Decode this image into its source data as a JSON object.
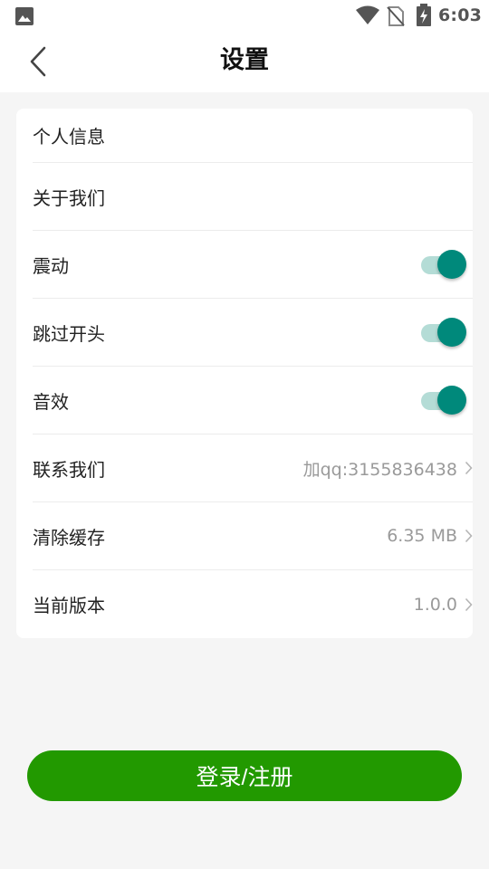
{
  "status_bar": {
    "time": "6:03",
    "icons": [
      "gallery-icon",
      "wifi-icon",
      "no-sim-icon",
      "battery-charging-icon"
    ]
  },
  "header": {
    "title": "设置",
    "back_icon": "chevron-left-icon"
  },
  "settings": {
    "items": [
      {
        "label": "个人信息",
        "type": "link"
      },
      {
        "label": "关于我们",
        "type": "link"
      },
      {
        "label": "震动",
        "type": "toggle",
        "enabled": true
      },
      {
        "label": "跳过开头",
        "type": "toggle",
        "enabled": true
      },
      {
        "label": "音效",
        "type": "toggle",
        "enabled": true
      },
      {
        "label": "联系我们",
        "type": "value",
        "value": "加qq:3155836438"
      },
      {
        "label": "清除缓存",
        "type": "value",
        "value": "6.35 MB"
      },
      {
        "label": "当前版本",
        "type": "value",
        "value": "1.0.0"
      }
    ]
  },
  "login_button_label": "登录/注册",
  "colors": {
    "accent_green": "#229900",
    "toggle_thumb": "#00897b",
    "toggle_track": "#b4dcd6",
    "background": "#f5f5f5"
  }
}
